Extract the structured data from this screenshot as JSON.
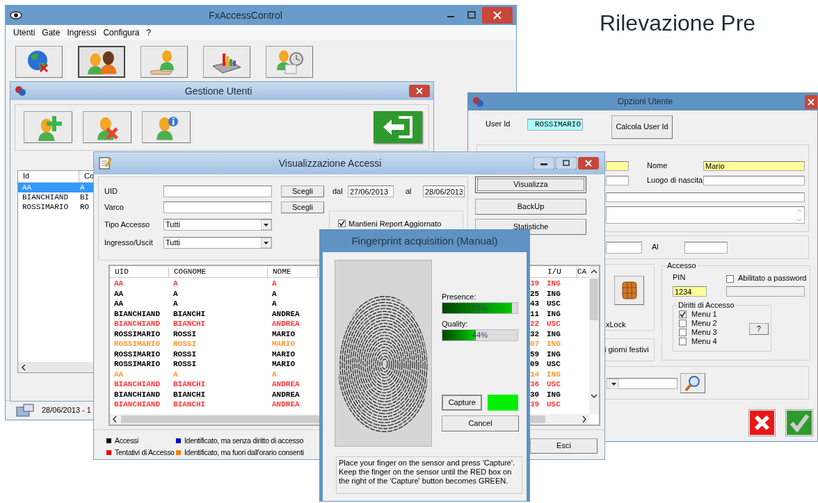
{
  "slide_title": "Rilevazione Pre",
  "main_window": {
    "title": "FxAccessControl",
    "menu": [
      "Utenti",
      "Gate",
      "Ingressi",
      "Configura",
      "?"
    ],
    "toolbar": [
      {
        "kind": "globe",
        "pressed": false
      },
      {
        "kind": "users",
        "pressed": true
      },
      {
        "kind": "handover",
        "pressed": false
      },
      {
        "kind": "chart",
        "pressed": false
      },
      {
        "kind": "schedule",
        "pressed": false
      }
    ],
    "status_bar": "28/06/2013 - 1"
  },
  "users_window": {
    "title": "Gestione Utenti",
    "toolbar": [
      {
        "kind": "add"
      },
      {
        "kind": "delete"
      },
      {
        "kind": "info"
      },
      {
        "kind": "exit"
      }
    ],
    "list": {
      "columns": [
        "Id",
        "Co"
      ],
      "rows": [
        {
          "cells": [
            "AA",
            "A"
          ],
          "selected": true
        },
        {
          "cells": [
            "BIANCHIAND",
            "BI"
          ],
          "selected": false
        },
        {
          "cells": [
            "ROSSIMARIO",
            "RO"
          ],
          "selected": false
        }
      ]
    }
  },
  "options_window": {
    "title": "Opzioni Utente",
    "user_id_label": "User Id",
    "user_id": "ROSSIMARIO",
    "calc_button": "Calcola User Id",
    "name_label": "Nome",
    "name": "Mario",
    "birthplace_label": "Luogo di nascita",
    "to_label": "Al",
    "lock_label": "xLock",
    "holidays_label": "i giorni festivi",
    "access": {
      "title": "Accesso",
      "pin_label": "PIN",
      "pin": "1234",
      "password_enabled": {
        "label": "Abilitato a password",
        "checked": false
      },
      "rights": {
        "title": "Diritti di Accesso",
        "help_button": "?",
        "items": [
          {
            "label": "Menu 1",
            "checked": true
          },
          {
            "label": "Menu 2",
            "checked": false
          },
          {
            "label": "Menu 3",
            "checked": false
          },
          {
            "label": "Menu 4",
            "checked": false
          }
        ]
      }
    }
  },
  "accesses_window": {
    "title": "Visualizzazione Accessi",
    "uid_label": "UID",
    "uid_button": "Scegli",
    "gate_label": "Varco",
    "gate_button": "Scegli",
    "type_label": "Tipo Accesso",
    "type_value": "Tutti",
    "direction_label": "Ingresso/Uscit",
    "direction_value": "Tutti",
    "from_label": "dal",
    "from_date": "27/06/2013",
    "to_label": "al",
    "to_date": "28/06/2013",
    "keep_updated": {
      "label": "Mantieni Report Aggiornato",
      "checked": true
    },
    "buttons": [
      "Visualizza",
      "BackUp",
      "Statistiche"
    ],
    "table": {
      "columns": [
        "UID",
        "COGNOME",
        "NOME",
        "I/U",
        "CA"
      ],
      "rows": [
        {
          "uid": "AA",
          "surname": "A",
          "name": "A",
          "column_4": "39",
          "direction": "ING",
          "color": "#ff3a3a"
        },
        {
          "uid": "AA",
          "surname": "A",
          "name": "A",
          "column_4": "25",
          "direction": "ING",
          "color": "#000000"
        },
        {
          "uid": "AA",
          "surname": "A",
          "name": "A",
          "column_4": "43",
          "direction": "USC",
          "color": "#000000"
        },
        {
          "uid": "BIANCHIAND",
          "surname": "BIANCHI",
          "name": "ANDREA",
          "column_4": "11",
          "direction": "ING",
          "color": "#000000"
        },
        {
          "uid": "BIANCHIAND",
          "surname": "BIANCHI",
          "name": "ANDREA",
          "column_4": "22",
          "direction": "USC",
          "color": "#ff3a3a"
        },
        {
          "uid": "ROSSIMARIO",
          "surname": "ROSSI",
          "name": "MARIO",
          "column_4": "32",
          "direction": "ING",
          "color": "#000000"
        },
        {
          "uid": "ROSSIMARIO",
          "surname": "ROSSI",
          "name": "MARIO",
          "column_4": "07",
          "direction": "ING",
          "color": "#ff9933"
        },
        {
          "uid": "ROSSIMARIO",
          "surname": "ROSSI",
          "name": "MARIO",
          "column_4": "59",
          "direction": "ING",
          "color": "#000000"
        },
        {
          "uid": "ROSSIMARIO",
          "surname": "ROSSI",
          "name": "MARIO",
          "column_4": "09",
          "direction": "USC",
          "color": "#000000"
        },
        {
          "uid": "AA",
          "surname": "A",
          "name": "A",
          "column_4": "14",
          "direction": "ING",
          "color": "#ff9933"
        },
        {
          "uid": "BIANCHIAND",
          "surname": "BIANCHI",
          "name": "ANDREA",
          "column_4": "36",
          "direction": "USC",
          "color": "#ff3a3a"
        },
        {
          "uid": "BIANCHIAND",
          "surname": "BIANCHI",
          "name": "ANDREA",
          "column_4": "30",
          "direction": "ING",
          "color": "#000000"
        },
        {
          "uid": "BIANCHIAND",
          "surname": "BIANCHI",
          "name": "ANDREA",
          "column_4": "39",
          "direction": "USC",
          "color": "#ff3a3a"
        }
      ]
    },
    "legend": [
      {
        "label": "Accessi",
        "color": "#000000"
      },
      {
        "label": "Identificato, ma senza diritto di accesso",
        "color": "#0000cc"
      },
      {
        "label": "Tentativi di Accesso",
        "color": "#ee0000"
      },
      {
        "label": "Identificato, ma fuori dall'orario consenti",
        "color": "#ff8000"
      }
    ],
    "exit_button": "Esci"
  },
  "fingerprint_window": {
    "title": "Fingerprint acquisition (Manual)",
    "presence": {
      "label": "Presence:",
      "level": 0.93,
      "reading": "93%"
    },
    "quality": {
      "label": "Quality:",
      "level": 0.44,
      "reading": "44%"
    },
    "capture_button": "Capture",
    "capture_ok": true,
    "cancel_button": "Cancel",
    "message": "Place your finger on the sensor and press 'Capture'. Keep the finger on the sensor until the RED box on the right of the 'Capture' button becomes GREEN."
  }
}
